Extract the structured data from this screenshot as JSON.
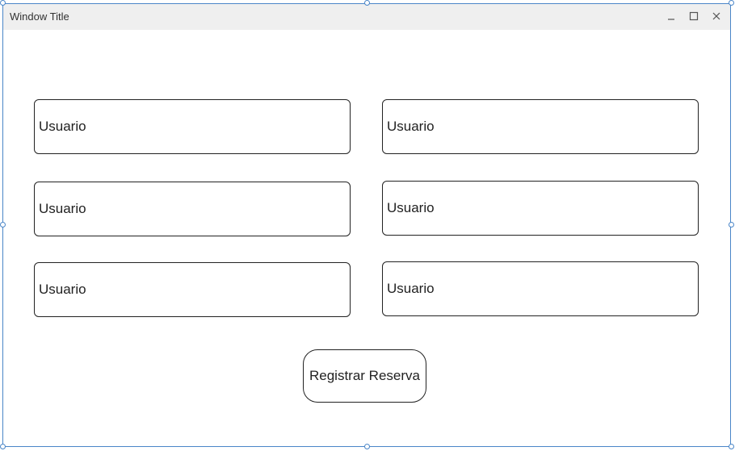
{
  "window": {
    "title": "Window Title",
    "controls": [
      "minimize-icon",
      "maximize-icon",
      "close-icon"
    ]
  },
  "form": {
    "fields": [
      {
        "label": "Usuario"
      },
      {
        "label": "Usuario"
      },
      {
        "label": "Usuario"
      },
      {
        "label": "Usuario"
      },
      {
        "label": "Usuario"
      },
      {
        "label": "Usuario"
      }
    ],
    "submit_label": "Registrar Reserva"
  },
  "colors": {
    "selection_border": "#4a86c8",
    "titlebar_bg": "#efefef",
    "field_border": "#222222"
  }
}
